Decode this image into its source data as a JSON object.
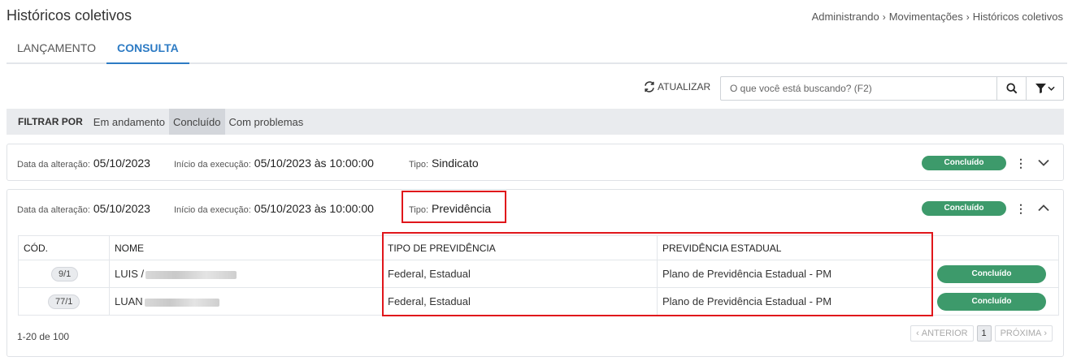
{
  "page": {
    "title": "Históricos coletivos",
    "breadcrumb": [
      "Administrando",
      "Movimentações",
      "Históricos coletivos"
    ]
  },
  "tabs": [
    {
      "label": "LANÇAMENTO",
      "active": false
    },
    {
      "label": "CONSULTA",
      "active": true
    }
  ],
  "toolbar": {
    "refresh_label": "ATUALIZAR",
    "search_placeholder": "O que você está buscando? (F2)",
    "search_value": ""
  },
  "filter": {
    "label": "FILTRAR POR",
    "options": [
      "Em andamento",
      "Concluído",
      "Com problemas"
    ],
    "selected": "Concluído"
  },
  "cards": [
    {
      "date_label": "Data da alteração:",
      "date_value": "05/10/2023",
      "start_label": "Início da execução:",
      "start_value": "05/10/2023 às 10:00:00",
      "type_label": "Tipo:",
      "type_value": "Sindicato",
      "status": "Concluído",
      "expanded": false
    },
    {
      "date_label": "Data da alteração:",
      "date_value": "05/10/2023",
      "start_label": "Início da execução:",
      "start_value": "05/10/2023 às 10:00:00",
      "type_label": "Tipo:",
      "type_value": "Previdência",
      "status": "Concluído",
      "expanded": true,
      "table": {
        "headers": [
          "CÓD.",
          "NOME",
          "TIPO DE PREVIDÊNCIA",
          "PREVIDÊNCIA ESTADUAL",
          ""
        ],
        "rows": [
          {
            "code": "9/1",
            "name": "LUIS /",
            "tipo": "Federal, Estadual",
            "estadual": "Plano de Previdência Estadual - PM",
            "status": "Concluído"
          },
          {
            "code": "77/1",
            "name": "LUAN",
            "tipo": "Federal, Estadual",
            "estadual": "Plano de Previdência Estadual - PM",
            "status": "Concluído"
          }
        ]
      },
      "pagination": {
        "range": "1-20 de 100",
        "prev": "ANTERIOR",
        "page": "1",
        "next": "PRÓXIMA"
      }
    }
  ],
  "colors": {
    "accent": "#2d7bc4",
    "success": "#3d9a6b",
    "highlight": "#e0161b"
  }
}
